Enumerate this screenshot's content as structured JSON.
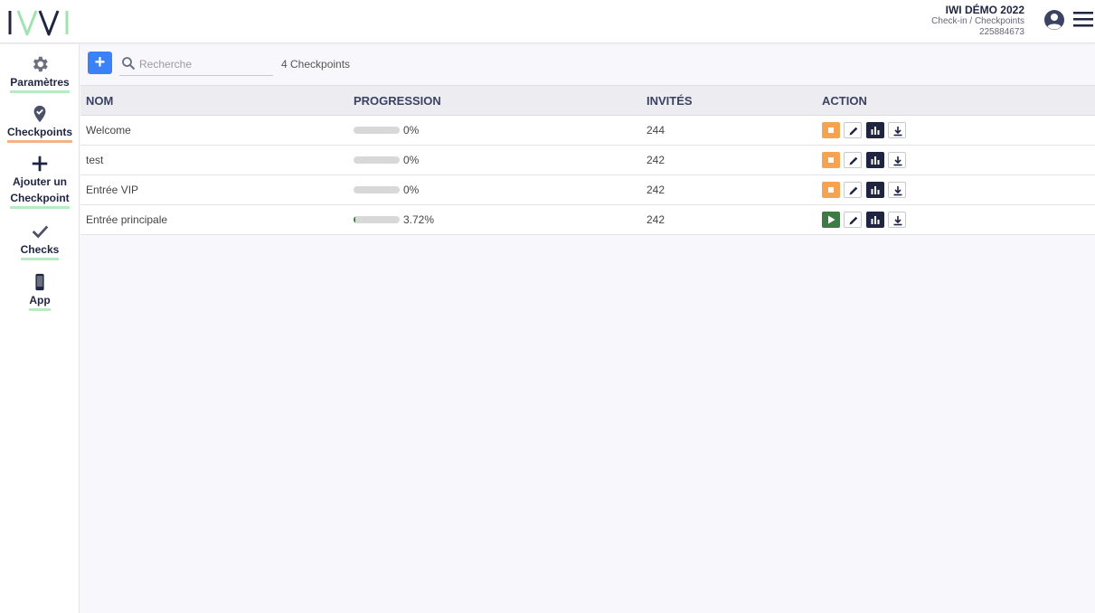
{
  "header": {
    "event_title": "IWI DÉMO 2022",
    "breadcrumb": "Check-in / Checkpoints",
    "event_id": "225884673",
    "icons": {
      "logo": "iwi-logo",
      "avatar": "user-avatar-icon",
      "menu": "hamburger-menu-icon"
    }
  },
  "sidebar": {
    "items": [
      {
        "label": "Paramètres",
        "icon": "gear-icon",
        "underline": "#b6ecc0"
      },
      {
        "label": "Checkpoints",
        "icon": "location-check-icon",
        "underline": "#f4b28b",
        "active": true
      },
      {
        "label_line1": "Ajouter un",
        "label_line2": "Checkpoint",
        "icon": "plus-icon",
        "underline": "#b6ecc0"
      },
      {
        "label": "Checks",
        "icon": "checkmark-icon",
        "underline": "#b6ecc0"
      },
      {
        "label": "App",
        "icon": "smartphone-icon",
        "underline": "#b6ecc0"
      }
    ]
  },
  "toolbar": {
    "add_label": "+",
    "search_placeholder": "Recherche",
    "count_text": "4 Checkpoints"
  },
  "table": {
    "headers": [
      "NOM",
      "PROGRESSION",
      "INVITÉS",
      "ACTION"
    ],
    "rows": [
      {
        "nom": "Welcome",
        "progress_text": "0%",
        "progress": 0,
        "invites": "244",
        "state": "stop"
      },
      {
        "nom": "test",
        "progress_text": "0%",
        "progress": 0,
        "invites": "242",
        "state": "stop"
      },
      {
        "nom": "Entrée VIP",
        "progress_text": "0%",
        "progress": 0,
        "invites": "242",
        "state": "stop"
      },
      {
        "nom": "Entrée principale",
        "progress_text": "3.72%",
        "progress": 3.72,
        "invites": "242",
        "state": "play"
      }
    ]
  },
  "colors": {
    "accent_blue": "#3b82f6",
    "navy": "#1f2540",
    "stop_orange": "#f7a250",
    "play_green": "#3f7a45",
    "progress_fill": "#3a7a3f"
  }
}
